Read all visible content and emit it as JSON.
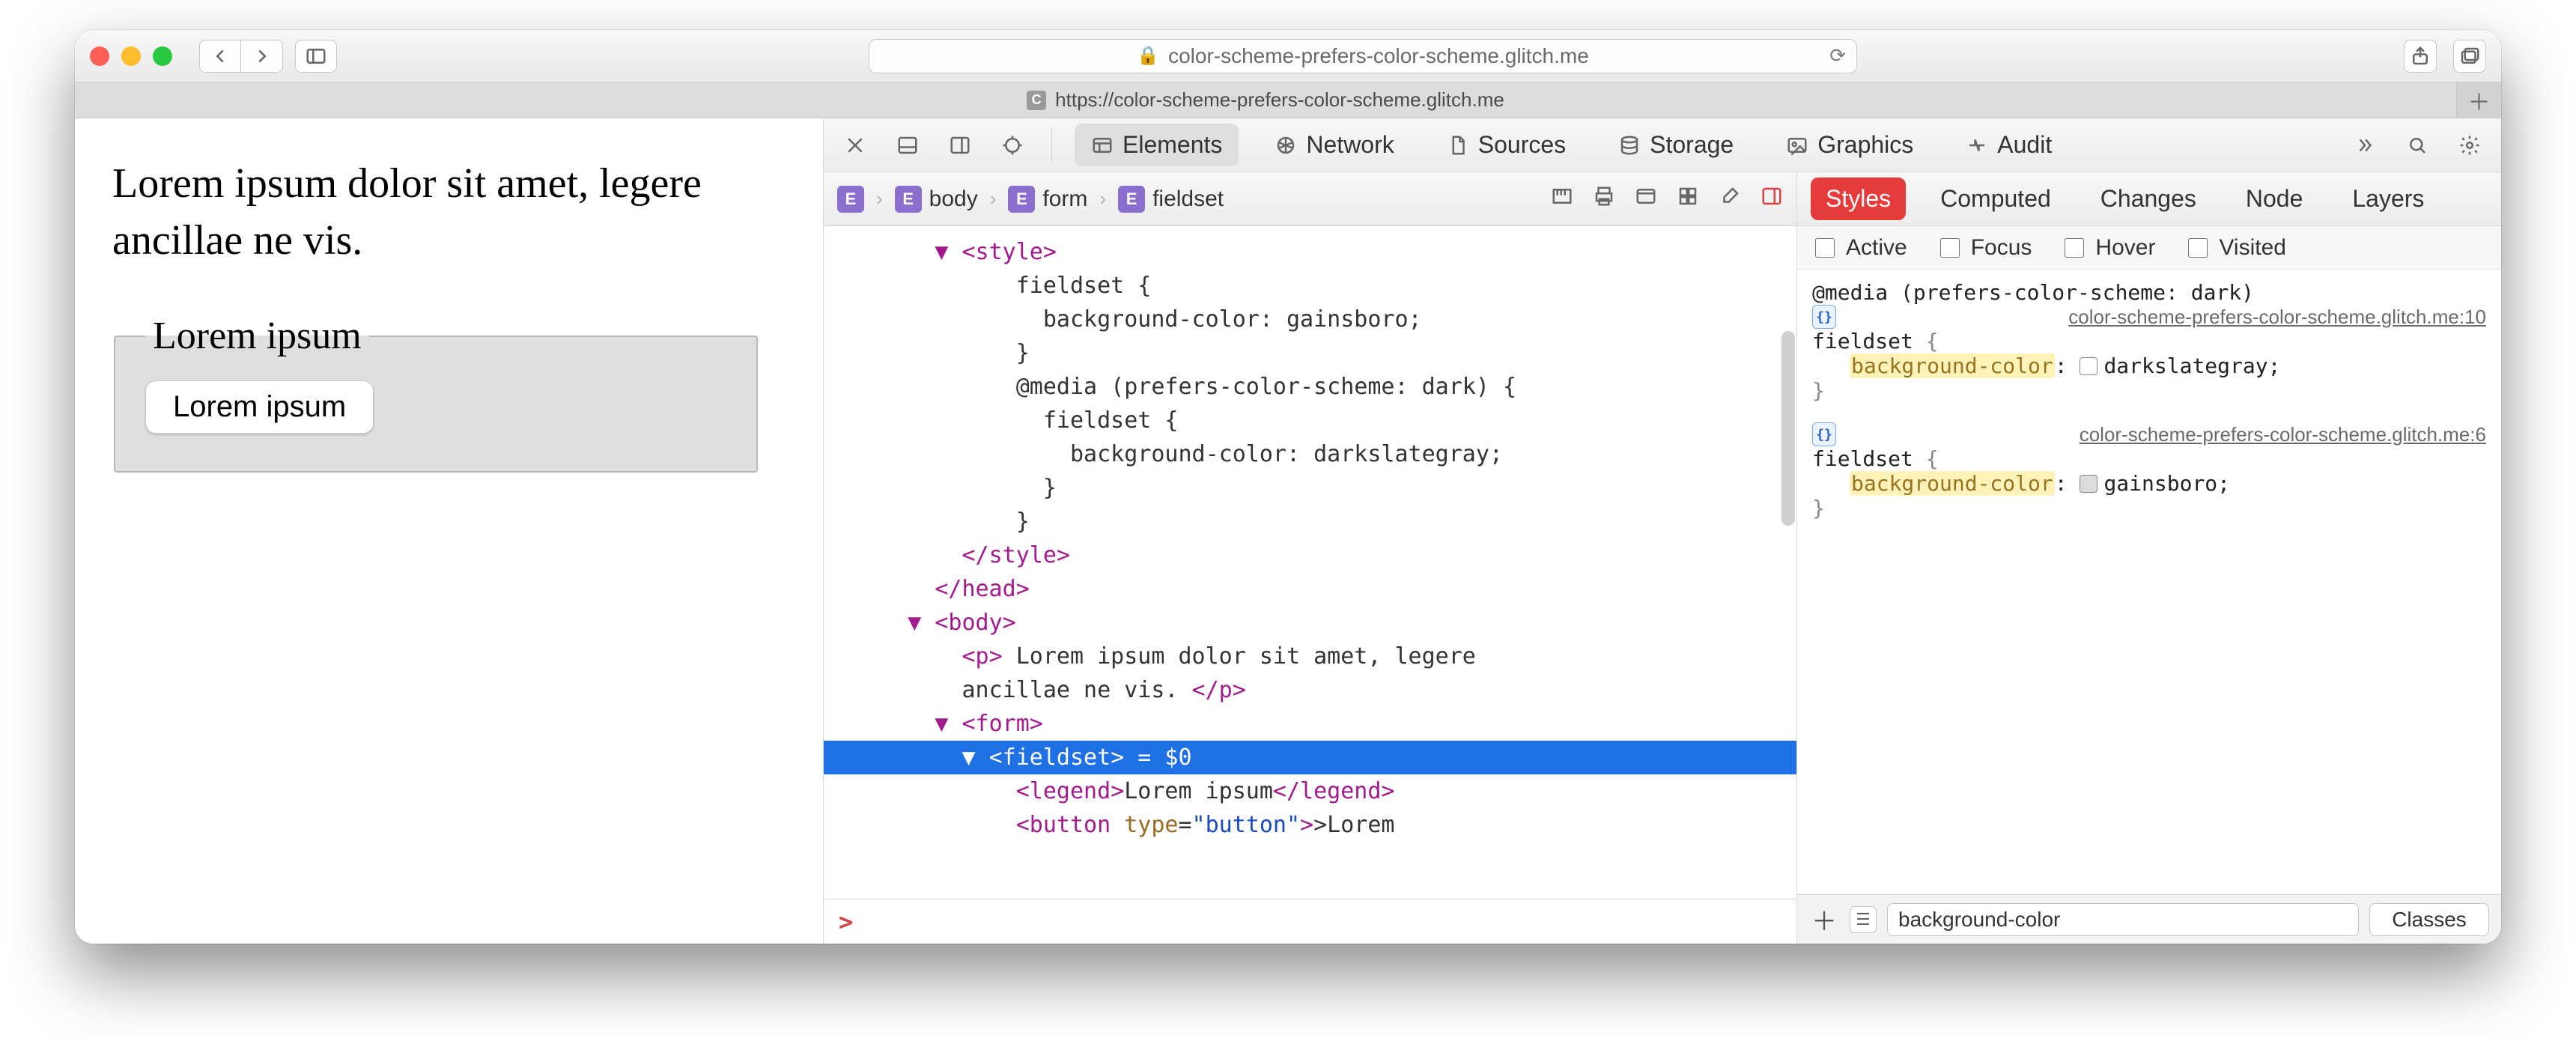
{
  "browser": {
    "url_display": "color-scheme-prefers-color-scheme.glitch.me",
    "tab_title": "https://color-scheme-prefers-color-scheme.glitch.me",
    "favicon_letter": "C"
  },
  "page": {
    "paragraph": "Lorem ipsum dolor sit amet, legere ancillae ne vis.",
    "legend": "Lorem ipsum",
    "button": "Lorem ipsum"
  },
  "devtools": {
    "tabs": {
      "elements": "Elements",
      "network": "Network",
      "sources": "Sources",
      "storage": "Storage",
      "graphics": "Graphics",
      "audit": "Audit"
    },
    "breadcrumb": {
      "badge": "E",
      "items": [
        "body",
        "form",
        "fieldset"
      ]
    },
    "dom_lines": {
      "l0": "      ▼ <style>",
      "l1": "            fieldset {",
      "l2": "              background-color: gainsboro;",
      "l3": "            }",
      "l4": "            @media (prefers-color-scheme: dark) {",
      "l5": "              fieldset {",
      "l6": "                background-color: darkslategray;",
      "l7": "              }",
      "l8": "            }",
      "l9": "        </style>",
      "l10": "      </head>",
      "l11": "    ▼ <body>",
      "l12": "        <p> Lorem ipsum dolor sit amet, legere",
      "l12b": "        ancillae ne vis. </p>",
      "l13": "      ▼ <form>",
      "l14_pre": "        ▼ ",
      "l14_tag": "<fieldset>",
      "l14_eq": " = $0",
      "l15a": "            <legend>",
      "l15b": "Lorem ipsum",
      "l15c": "</legend>",
      "l16a": "            <button ",
      "l16attr": "type",
      "l16eq": "=",
      "l16val": "\"button\"",
      "l16b": ">Lorem"
    },
    "console_prompt": ">",
    "styles_tabs": {
      "styles": "Styles",
      "computed": "Computed",
      "changes": "Changes",
      "node": "Node",
      "layers": "Layers"
    },
    "pseudo": {
      "active": "Active",
      "focus": "Focus",
      "hover": "Hover",
      "visited": "Visited"
    },
    "rules": {
      "r1": {
        "media": "@media (prefers-color-scheme: dark)",
        "source": "color-scheme-prefers-color-scheme.glitch.me:10",
        "selector": "fieldset",
        "prop_name": "background-color",
        "prop_value": "darkslategray",
        "swatch": "#2f4f4f"
      },
      "r2": {
        "source": "color-scheme-prefers-color-scheme.glitch.me:6",
        "selector": "fieldset",
        "prop_name": "background-color",
        "prop_value": "gainsboro",
        "swatch": "#dcdcdc"
      }
    },
    "filter_value": "background-color",
    "classes_label": "Classes"
  }
}
